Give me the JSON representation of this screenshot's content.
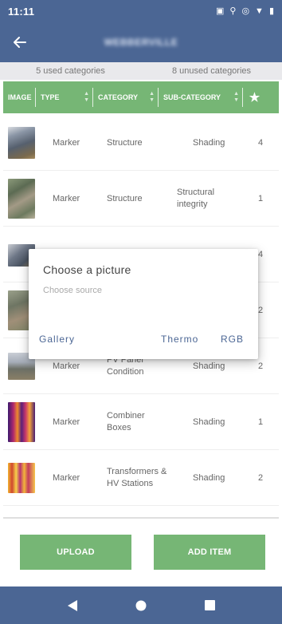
{
  "status": {
    "time": "11:11"
  },
  "appbar": {
    "title": "WEBBERVILLE"
  },
  "summary": {
    "used": "5 used categories",
    "unused": "8 unused categories"
  },
  "table": {
    "headers": {
      "image": "IMAGE",
      "type": "TYPE",
      "category": "CATEGORY",
      "subcategory": "SUB-CATEGORY",
      "star": "★"
    },
    "rows": [
      {
        "type": "Marker",
        "category": "Structure",
        "subcategory": "Shading",
        "count": "4"
      },
      {
        "type": "Marker",
        "category": "Structure",
        "subcategory": "Structural integrity",
        "count": "1"
      },
      {
        "type": "",
        "category": "",
        "subcategory": "",
        "count": "4"
      },
      {
        "type": "",
        "category": "",
        "subcategory": "",
        "count": "2"
      },
      {
        "type": "Marker",
        "category": "PV Panel Condition",
        "subcategory": "Shading",
        "count": "2"
      },
      {
        "type": "Marker",
        "category": "Combiner Boxes",
        "subcategory": "Shading",
        "count": "1"
      },
      {
        "type": "Marker",
        "category": "Transformers & HV Stations",
        "subcategory": "Shading",
        "count": "2"
      }
    ]
  },
  "buttons": {
    "upload": "UPLOAD",
    "add_item": "ADD ITEM"
  },
  "dialog": {
    "title": "Choose a picture",
    "subtitle": "Choose source",
    "gallery": "Gallery",
    "thermo": "Thermo",
    "rgb": "RGB"
  },
  "colors": {
    "primary": "#4b6694",
    "accent": "#76b675",
    "summary_bg": "#e9e9ec"
  }
}
